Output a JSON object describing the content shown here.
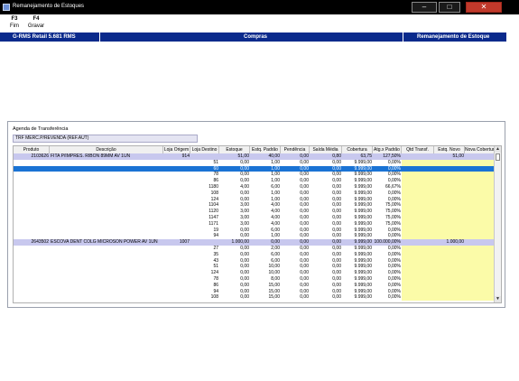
{
  "window": {
    "title": "Remanejamento de Estoques"
  },
  "toolbar": {
    "f3_key": "F3",
    "f3_label": "Fim",
    "f4_key": "F4",
    "f4_label": "Gravar"
  },
  "header": {
    "left": "G-RMS Retail 5.681 RMS",
    "center": "Compras",
    "right": "Remanejamento de Estoque"
  },
  "section": {
    "label": "Agenda de Transferência",
    "agenda_value": "TRF MERC.P/REVENDA (REF.AUT)"
  },
  "grid": {
    "columns": [
      "Produto",
      "Descrição",
      "Loja Origem",
      "Loja Destino",
      "Estoque",
      "Estq. Padrão",
      "Pendência",
      "Saída Média",
      "Cobertura",
      "Atg.x Padrão",
      "Qtd Transf.",
      "Estq. Novo",
      "Nova Cobertura"
    ],
    "rows": [
      {
        "type": "group",
        "produto": "2103626",
        "descricao": "FITA P/IMPRES. RIBON 89MM      AV   1UN",
        "loja_origem": "914",
        "loja_destino": "",
        "estoque": "51,00",
        "estq_padrao": "40,00",
        "pendencia": "0,00",
        "saida_media": "0,80",
        "cobertura": "63,75",
        "atg": "127,50%",
        "qtd_transf": "",
        "estq_novo": "51,00",
        "nova_cob": ""
      },
      {
        "type": "item",
        "loja_destino": "51",
        "estoque": "0,00",
        "estq_padrao": "1,00",
        "pendencia": "0,00",
        "saida_media": "0,00",
        "cobertura": "9.999,00",
        "atg": "0,00%"
      },
      {
        "type": "sel",
        "loja_destino": "60",
        "estoque": "0,00",
        "estq_padrao": "1,00",
        "pendencia": "0,00",
        "saida_media": "0,00",
        "cobertura": "9.999,00",
        "atg": "0,00%"
      },
      {
        "type": "item",
        "loja_destino": "78",
        "estoque": "0,00",
        "estq_padrao": "1,00",
        "pendencia": "0,00",
        "saida_media": "0,00",
        "cobertura": "9.999,00",
        "atg": "0,00%"
      },
      {
        "type": "item",
        "loja_destino": "86",
        "estoque": "0,00",
        "estq_padrao": "1,00",
        "pendencia": "0,00",
        "saida_media": "0,00",
        "cobertura": "9.999,00",
        "atg": "0,00%"
      },
      {
        "type": "item",
        "loja_destino": "1180",
        "estoque": "4,00",
        "estq_padrao": "6,00",
        "pendencia": "0,00",
        "saida_media": "0,00",
        "cobertura": "9.999,00",
        "atg": "66,67%"
      },
      {
        "type": "item",
        "loja_destino": "108",
        "estoque": "0,00",
        "estq_padrao": "1,00",
        "pendencia": "0,00",
        "saida_media": "0,00",
        "cobertura": "9.999,00",
        "atg": "0,00%"
      },
      {
        "type": "item",
        "loja_destino": "124",
        "estoque": "0,00",
        "estq_padrao": "1,00",
        "pendencia": "0,00",
        "saida_media": "0,00",
        "cobertura": "9.999,00",
        "atg": "0,00%"
      },
      {
        "type": "item",
        "loja_destino": "1104",
        "estoque": "3,00",
        "estq_padrao": "4,00",
        "pendencia": "0,00",
        "saida_media": "0,00",
        "cobertura": "9.999,00",
        "atg": "75,00%"
      },
      {
        "type": "item",
        "loja_destino": "1120",
        "estoque": "3,00",
        "estq_padrao": "4,00",
        "pendencia": "0,00",
        "saida_media": "0,00",
        "cobertura": "9.999,00",
        "atg": "75,00%"
      },
      {
        "type": "item",
        "loja_destino": "1147",
        "estoque": "3,00",
        "estq_padrao": "4,00",
        "pendencia": "0,00",
        "saida_media": "0,00",
        "cobertura": "9.999,00",
        "atg": "75,00%"
      },
      {
        "type": "item",
        "loja_destino": "1171",
        "estoque": "3,00",
        "estq_padrao": "4,00",
        "pendencia": "0,00",
        "saida_media": "0,00",
        "cobertura": "9.999,00",
        "atg": "75,00%"
      },
      {
        "type": "item",
        "loja_destino": "19",
        "estoque": "0,00",
        "estq_padrao": "6,00",
        "pendencia": "0,00",
        "saida_media": "0,00",
        "cobertura": "9.999,00",
        "atg": "0,00%"
      },
      {
        "type": "item",
        "loja_destino": "94",
        "estoque": "0,00",
        "estq_padrao": "1,00",
        "pendencia": "0,00",
        "saida_media": "0,00",
        "cobertura": "9.999,00",
        "atg": "0,00%"
      },
      {
        "type": "group",
        "produto": "2643502",
        "descricao": "ESCOVA DENT COLG MICROSON POWER AV  1UN",
        "loja_origem": "1007",
        "loja_destino": "",
        "estoque": "1.000,00",
        "estq_padrao": "0,00",
        "pendencia": "0,00",
        "saida_media": "0,00",
        "cobertura": "9.999,00",
        "atg": "100.000,00%",
        "qtd_transf": "",
        "estq_novo": "1.000,00",
        "nova_cob": ""
      },
      {
        "type": "item",
        "loja_destino": "27",
        "estoque": "0,00",
        "estq_padrao": "2,00",
        "pendencia": "0,00",
        "saida_media": "0,00",
        "cobertura": "9.999,00",
        "atg": "0,00%"
      },
      {
        "type": "item",
        "loja_destino": "35",
        "estoque": "0,00",
        "estq_padrao": "6,00",
        "pendencia": "0,00",
        "saida_media": "0,00",
        "cobertura": "9.999,00",
        "atg": "0,00%"
      },
      {
        "type": "item",
        "loja_destino": "43",
        "estoque": "0,00",
        "estq_padrao": "6,00",
        "pendencia": "0,00",
        "saida_media": "0,00",
        "cobertura": "9.999,00",
        "atg": "0,00%"
      },
      {
        "type": "item",
        "loja_destino": "51",
        "estoque": "0,00",
        "estq_padrao": "10,00",
        "pendencia": "0,00",
        "saida_media": "0,00",
        "cobertura": "9.999,00",
        "atg": "0,00%"
      },
      {
        "type": "item",
        "loja_destino": "124",
        "estoque": "0,00",
        "estq_padrao": "10,00",
        "pendencia": "0,00",
        "saida_media": "0,00",
        "cobertura": "9.999,00",
        "atg": "0,00%"
      },
      {
        "type": "item",
        "loja_destino": "78",
        "estoque": "0,00",
        "estq_padrao": "8,00",
        "pendencia": "0,00",
        "saida_media": "0,00",
        "cobertura": "9.999,00",
        "atg": "0,00%"
      },
      {
        "type": "item",
        "loja_destino": "86",
        "estoque": "0,00",
        "estq_padrao": "15,00",
        "pendencia": "0,00",
        "saida_media": "0,00",
        "cobertura": "9.999,00",
        "atg": "0,00%"
      },
      {
        "type": "item",
        "loja_destino": "94",
        "estoque": "0,00",
        "estq_padrao": "15,00",
        "pendencia": "0,00",
        "saida_media": "0,00",
        "cobertura": "9.999,00",
        "atg": "0,00%"
      },
      {
        "type": "item",
        "loja_destino": "108",
        "estoque": "0,00",
        "estq_padrao": "15,00",
        "pendencia": "0,00",
        "saida_media": "0,00",
        "cobertura": "9.999,00",
        "atg": "0,00%"
      }
    ]
  },
  "colors": {
    "header_bg": "#0a2a8c",
    "group_row": "#c8c8ee",
    "selected_row": "#1a73d4",
    "editable_col": "#fbfba8"
  },
  "icons": {
    "app": "app-icon",
    "minimize": "minimize-icon",
    "maximize": "maximize-icon",
    "close": "close-icon",
    "scroll_up": "scroll-up-icon",
    "scroll_down": "scroll-down-icon"
  }
}
